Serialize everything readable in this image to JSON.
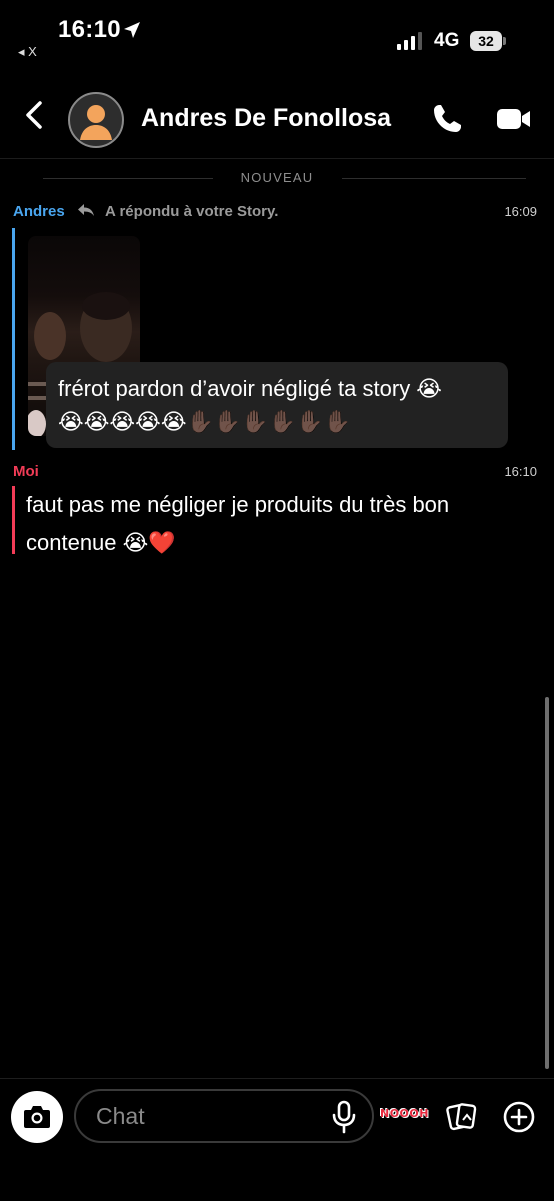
{
  "status_bar": {
    "time": "16:10",
    "back_app": "◂ X",
    "network": "4G",
    "battery": "32"
  },
  "header": {
    "contact_name": "Andres De Fonollosa"
  },
  "divider": {
    "label": "NOUVEAU"
  },
  "messages": [
    {
      "sender": "Andres",
      "reply_note": "A répondu à votre Story.",
      "time": "16:09",
      "text": "frérot pardon d’avoir négligé ta story 😭",
      "text_line2": "😭😭😭😭😭",
      "text_hands": "✋🏿✋🏿✋🏿✋🏿✋🏿✋🏿"
    },
    {
      "sender": "Moi",
      "time": "16:10",
      "text": "faut pas me négliger je produits du très bon contenue 😭❤️"
    }
  ],
  "composer": {
    "placeholder": "Chat",
    "sticker_text": "NOOOH"
  },
  "colors": {
    "andres": "#4aa6ef",
    "moi": "#f23c57",
    "background": "#000000"
  }
}
